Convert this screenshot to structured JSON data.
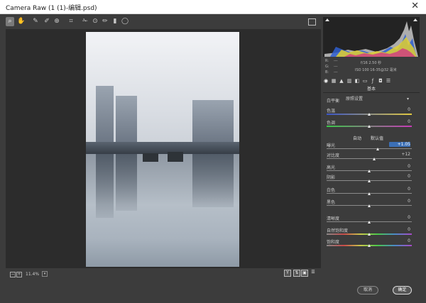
{
  "window": {
    "title": "Camera Raw (1 (1)-编辑.psd)"
  },
  "toolbar": {
    "tools": [
      "zoom-tool-icon",
      "hand-tool-icon",
      "white-balance-tool-icon",
      "color-sampler-tool-icon",
      "targeted-adjustment-tool-icon",
      "crop-tool-icon",
      "spot-removal-tool-icon",
      "red-eye-tool-icon",
      "adjustment-brush-icon",
      "graduated-filter-icon",
      "radial-filter-icon"
    ],
    "active_tool": "zoom-tool-icon"
  },
  "status": {
    "zoom_level": "11.4%"
  },
  "exif": {
    "r_label": "R:",
    "g_label": "G:",
    "b_label": "B:",
    "r_value": "---",
    "g_value": "---",
    "b_value": "---",
    "aperture_shutter": "f/16   2.50 秒",
    "iso_lens": "ISO 100   16-35@32 毫米"
  },
  "panel": {
    "section_title": "基本",
    "white_balance_label": "白平衡",
    "white_balance_value": "原照设置",
    "auto_label": "自动",
    "default_label": "默认值"
  },
  "sliders_top": [
    {
      "label": "色温",
      "value": "0",
      "level": 0.5
    },
    {
      "label": "色调",
      "value": "0",
      "level": 0.5
    }
  ],
  "sliders_tone": [
    {
      "label": "曝光",
      "value": "+1.05",
      "level": 0.6
    },
    {
      "label": "对比度",
      "value": "+12",
      "level": 0.56
    },
    {
      "label": "高光",
      "value": "0",
      "level": 0.5
    },
    {
      "label": "阴影",
      "value": "0",
      "level": 0.5
    },
    {
      "label": "白色",
      "value": "0",
      "level": 0.5
    },
    {
      "label": "黑色",
      "value": "0",
      "level": 0.5
    }
  ],
  "sliders_presence": [
    {
      "label": "清晰度",
      "value": "0",
      "level": 0.5
    },
    {
      "label": "自然饱和度",
      "value": "0",
      "level": 0.5
    },
    {
      "label": "饱和度",
      "value": "0",
      "level": 0.5
    }
  ],
  "buttons": {
    "cancel": "取消",
    "ok": "确定"
  },
  "colors": {
    "background": "#3c3c3c",
    "canvas": "#2c2c2c",
    "highlight": "#3b6fb6"
  }
}
